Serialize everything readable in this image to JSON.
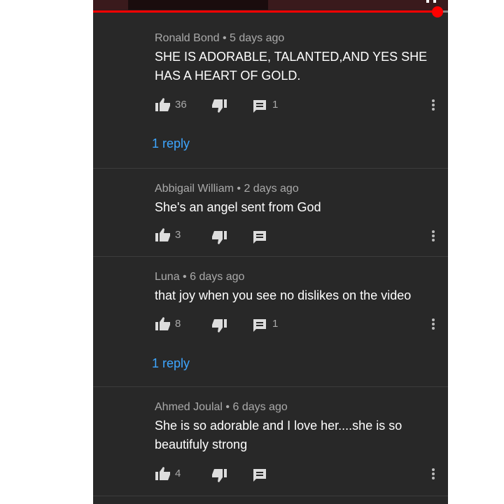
{
  "comments": [
    {
      "author": "Ronald Bond",
      "time": "5 days ago",
      "text": "SHE IS ADORABLE, TALANTED,AND YES SHE HAS A HEART OF GOLD.",
      "likes": "36",
      "replies_count": "1",
      "reply_link": "1 reply"
    },
    {
      "author": "Abbigail William",
      "time": "2 days ago",
      "text": "She's an angel sent from God",
      "likes": "3"
    },
    {
      "author": "Luna",
      "time": "6 days ago",
      "text": "that joy when you see no dislikes on the video",
      "likes": "8",
      "replies_count": "1",
      "reply_link": "1 reply"
    },
    {
      "author": "Ahmed Joulal",
      "time": "6 days ago",
      "text": "She is so adorable and I love her....she is so beautifuly strong",
      "likes": "4"
    }
  ],
  "separator": "•",
  "colors": {
    "background": "#282828",
    "text": "#ffffff",
    "meta": "#aaaaaa",
    "link": "#3ea6ff",
    "progress": "#ff0000"
  },
  "icons": [
    "thumbs-up-icon",
    "thumbs-down-icon",
    "reply-comment-icon",
    "more-vert-icon"
  ]
}
